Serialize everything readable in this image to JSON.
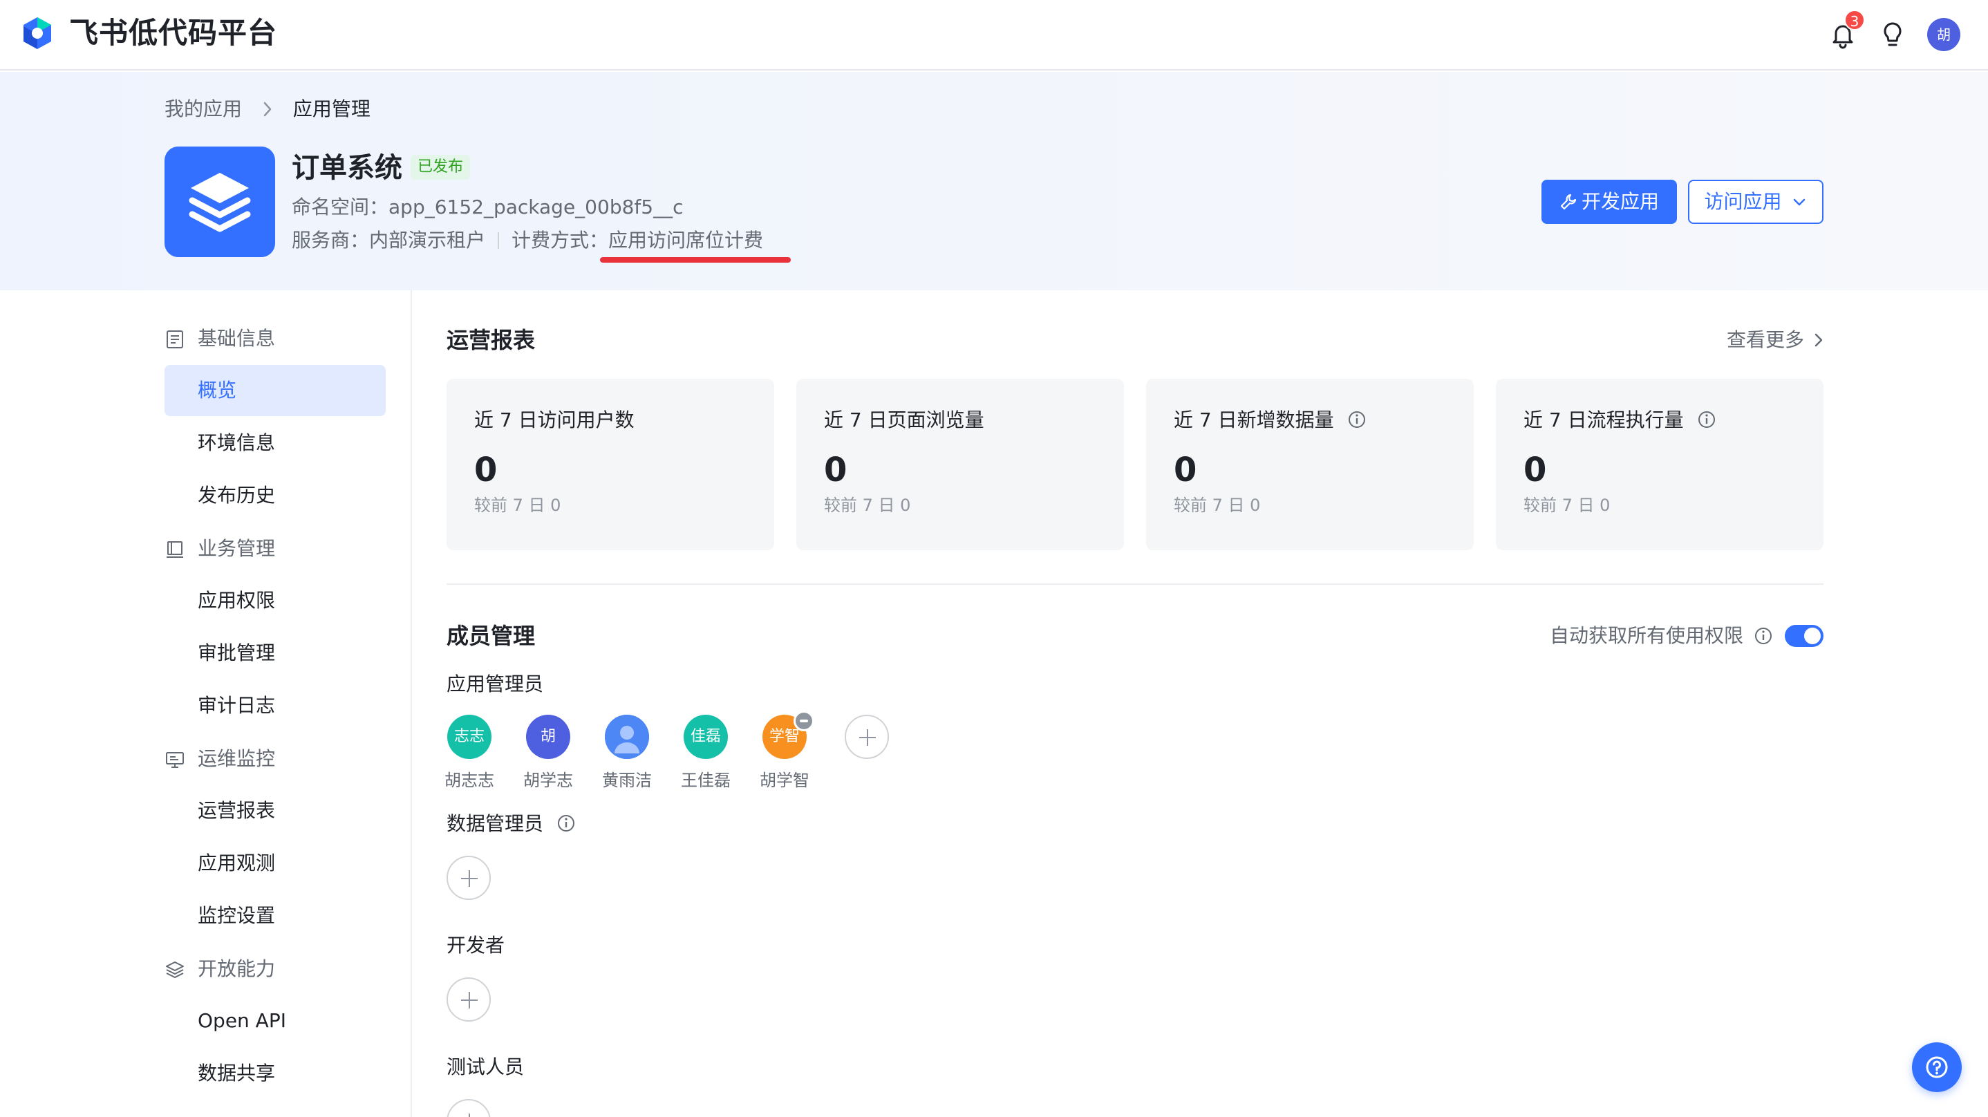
{
  "topbar": {
    "brand": "飞书低代码平台",
    "notification_count": "3",
    "user_avatar_text": "胡"
  },
  "breadcrumb": {
    "parent": "我的应用",
    "current": "应用管理"
  },
  "app": {
    "title": "订单系统",
    "status": "已发布",
    "namespace_label": "命名空间：",
    "namespace_value": "app_6152_package_00b8f5__c",
    "provider_label": "服务商：",
    "provider_value": "内部演示租户",
    "billing_label": "计费方式：",
    "billing_value": "应用访问席位计费",
    "icon_color": "#3370ff"
  },
  "actions": {
    "develop_label": "开发应用",
    "visit_label": "访问应用"
  },
  "sidebar": {
    "groups": [
      {
        "label": "基础信息",
        "icon": "document-icon"
      },
      {
        "label": "业务管理",
        "icon": "book-icon"
      },
      {
        "label": "运维监控",
        "icon": "monitor-icon"
      },
      {
        "label": "开放能力",
        "icon": "layers-icon"
      }
    ],
    "items": [
      {
        "label": "概览",
        "active": true
      },
      {
        "label": "环境信息"
      },
      {
        "label": "发布历史"
      },
      {
        "label": "应用权限"
      },
      {
        "label": "审批管理"
      },
      {
        "label": "审计日志"
      },
      {
        "label": "运营报表"
      },
      {
        "label": "应用观测"
      },
      {
        "label": "监控设置"
      },
      {
        "label": "Open API"
      },
      {
        "label": "数据共享"
      }
    ]
  },
  "report": {
    "title": "运营报表",
    "more_label": "查看更多",
    "cards": [
      {
        "label": "近 7 日访问用户数",
        "value": "0",
        "compare": "较前 7 日   0",
        "info": false
      },
      {
        "label": "近 7 日页面浏览量",
        "value": "0",
        "compare": "较前 7 日   0",
        "info": false
      },
      {
        "label": "近 7 日新增数据量",
        "value": "0",
        "compare": "较前 7 日   0",
        "info": true
      },
      {
        "label": "近 7 日流程执行量",
        "value": "0",
        "compare": "较前 7 日   0",
        "info": true
      }
    ]
  },
  "members": {
    "title": "成员管理",
    "auto_perm_label": "自动获取所有使用权限",
    "auto_perm_on": true,
    "admins_title": "应用管理员",
    "admins": [
      {
        "avatar": "志志",
        "name": "胡志志",
        "color": "#14c0a8"
      },
      {
        "avatar": "胡",
        "name": "胡学志",
        "color": "#4e5fe0"
      },
      {
        "avatar": "",
        "name": "黄雨洁",
        "color": "#4d86f5"
      },
      {
        "avatar": "佳磊",
        "name": "王佳磊",
        "color": "#14c0a8"
      },
      {
        "avatar": "学智",
        "name": "胡学智",
        "color": "#f7901e"
      }
    ],
    "data_admins_title": "数据管理员",
    "developers_title": "开发者",
    "testers_title": "测试人员"
  },
  "colors": {
    "accent": "#3370ff",
    "underline_mark": "#e8323c"
  }
}
